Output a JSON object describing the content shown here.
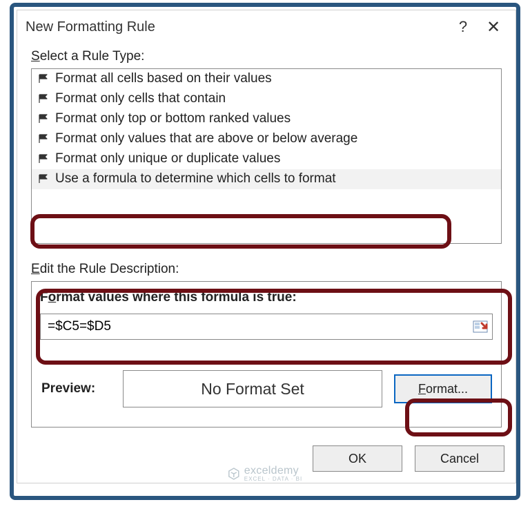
{
  "dialog": {
    "title": "New Formatting Rule",
    "help_symbol": "?",
    "close_symbol": "✕"
  },
  "ruleType": {
    "label_html": "Select a Rule Type:",
    "items": [
      "Format all cells based on their values",
      "Format only cells that contain",
      "Format only top or bottom ranked values",
      "Format only values that are above or below average",
      "Format only unique or duplicate values",
      "Use a formula to determine which cells to format"
    ],
    "selectedIndex": 5
  },
  "description": {
    "label": "Edit the Rule Description:",
    "formula_label": "Format values where this formula is true:",
    "formula_value": "=$C5=$D5",
    "preview_label": "Preview:",
    "preview_text": "No Format Set",
    "format_button": "Format..."
  },
  "buttons": {
    "ok": "OK",
    "cancel": "Cancel"
  },
  "watermark": {
    "brand": "exceldemy",
    "tag": "EXCEL · DATA · BI"
  }
}
